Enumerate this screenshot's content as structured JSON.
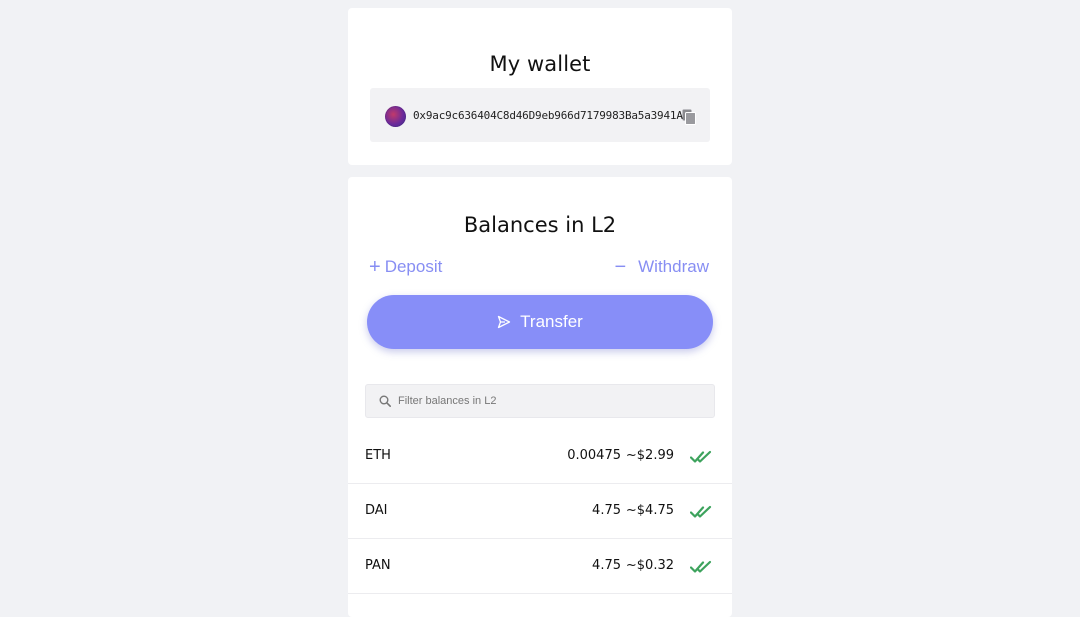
{
  "wallet": {
    "title": "My wallet",
    "address": "0x9ac9c636404C8d46D9eb966d7179983Ba5a3941A",
    "avatar_icon": "identicon-avatar",
    "copy_icon": "copy-icon"
  },
  "balances": {
    "title": "Balances in L2",
    "deposit_symbol": "+",
    "deposit_label": "Deposit",
    "withdraw_symbol": "−",
    "withdraw_label": "Withdraw",
    "transfer_label": "Transfer",
    "filter_placeholder": "Filter balances in L2",
    "tokens": [
      {
        "symbol": "ETH",
        "amount": "0.00475",
        "usd": "~$2.99",
        "status_icon": "double-check-icon"
      },
      {
        "symbol": "DAI",
        "amount": "4.75",
        "usd": "~$4.75",
        "status_icon": "double-check-icon"
      },
      {
        "symbol": "PAN",
        "amount": "4.75",
        "usd": "~$0.32",
        "status_icon": "double-check-icon"
      }
    ]
  },
  "colors": {
    "accent": "#878ef8",
    "verified": "#3da35d",
    "background": "#f1f2f5"
  }
}
